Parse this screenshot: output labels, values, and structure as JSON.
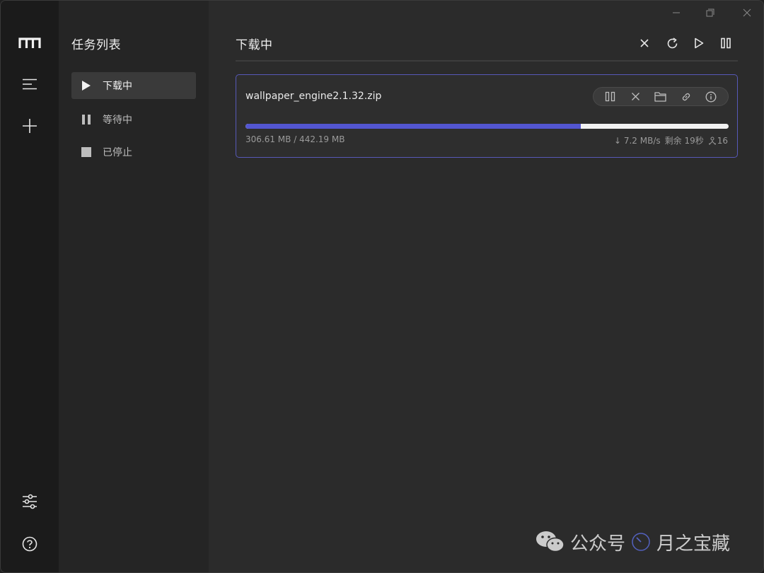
{
  "rail": {
    "items": [
      {
        "name": "logo-icon"
      },
      {
        "name": "menu-icon"
      },
      {
        "name": "add-icon"
      },
      {
        "name": "settings-sliders-icon"
      },
      {
        "name": "help-icon"
      }
    ]
  },
  "tasks": {
    "title": "任务列表",
    "items": [
      {
        "label": "下载中",
        "icon": "play-icon",
        "active": true
      },
      {
        "label": "等待中",
        "icon": "pause-icon",
        "active": false
      },
      {
        "label": "已停止",
        "icon": "stop-icon",
        "active": false
      }
    ]
  },
  "main": {
    "title": "下载中",
    "toolbar": [
      "close-icon",
      "refresh-icon",
      "play-icon",
      "pause-icon"
    ]
  },
  "download": {
    "file_name": "wallpaper_engine2.1.32.zip",
    "size_text": "306.61 MB / 442.19 MB",
    "progress": 0.6934,
    "speed": "↓ 7.2 MB/s",
    "remaining": "剩余 19秒",
    "connections": "16",
    "actions": [
      "pause-icon",
      "close-icon",
      "folder-icon",
      "link-icon",
      "info-icon"
    ]
  },
  "watermark": {
    "brand": "公众号",
    "name": "月之宝藏"
  },
  "colors": {
    "accent": "#5356d1",
    "card_border": "#5759b8"
  }
}
